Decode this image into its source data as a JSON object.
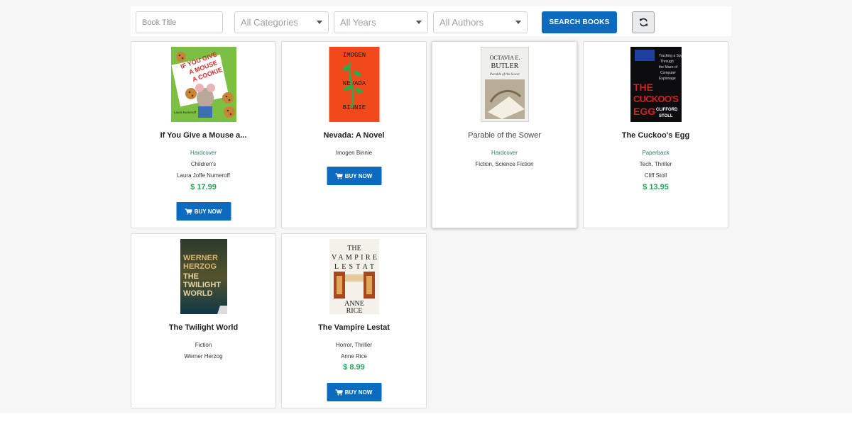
{
  "search": {
    "title_placeholder": "Book Title",
    "category_selected": "All Categories",
    "year_selected": "All Years",
    "author_selected": "All Authors",
    "search_button": "SEARCH BOOKS",
    "refresh_icon": "refresh-icon"
  },
  "books": [
    {
      "title": "If You Give a Mouse a...",
      "format": "Hardcover",
      "categories": "Children's",
      "author": "Laura Joffe Numeroff",
      "price": "$ 17.99",
      "buy_label": "BUY NOW",
      "cover": {
        "line1": "IF YOU GIVE",
        "line2": "A MOUSE",
        "line3": "A COOKIE",
        "author": "Laura Numeroff",
        "bg": "#7cc043"
      }
    },
    {
      "title": "Nevada: A Novel",
      "author": "Imogen Binnie",
      "buy_label": "BUY NOW",
      "cover": {
        "top": "IMOGEN",
        "mid": "NEVADA",
        "bottom": "BINNIE",
        "bg": "#f04a1c"
      }
    },
    {
      "title": "Parable of the Sower",
      "format": "Hardcover",
      "categories": "Fiction, Science Fiction",
      "cover": {
        "author": "OCTAVIA E. BUTLER",
        "sub": "Parable of the Sower"
      }
    },
    {
      "title": "The Cuckoo's Egg",
      "format": "Paperback",
      "categories": "Tech, Thriller",
      "author": "Cliff Stoll",
      "price": "$ 13.95",
      "cover": {
        "title1": "THE",
        "title2": "CUCKOO'S",
        "title3": "EGG",
        "author": "CLIFFORD STOLL"
      }
    },
    {
      "title": "The Twilight World",
      "categories": "Fiction",
      "author": "Werner Herzog",
      "cover": {
        "text": "WERNER HERZOG THE TWILIGHT WORLD"
      }
    },
    {
      "title": "The Vampire Lestat",
      "categories": "Horror, Thriller",
      "author": "Anne Rice",
      "price": "$ 8.99",
      "buy_label": "BUY NOW",
      "cover": {
        "t1": "THE",
        "t2": "VAMPIRE",
        "t3": "LESTAT",
        "a1": "ANNE",
        "a2": "RICE"
      }
    }
  ],
  "colors": {
    "accent": "#0d6bbf",
    "price": "#23a455",
    "format": "#2f7d5a"
  }
}
